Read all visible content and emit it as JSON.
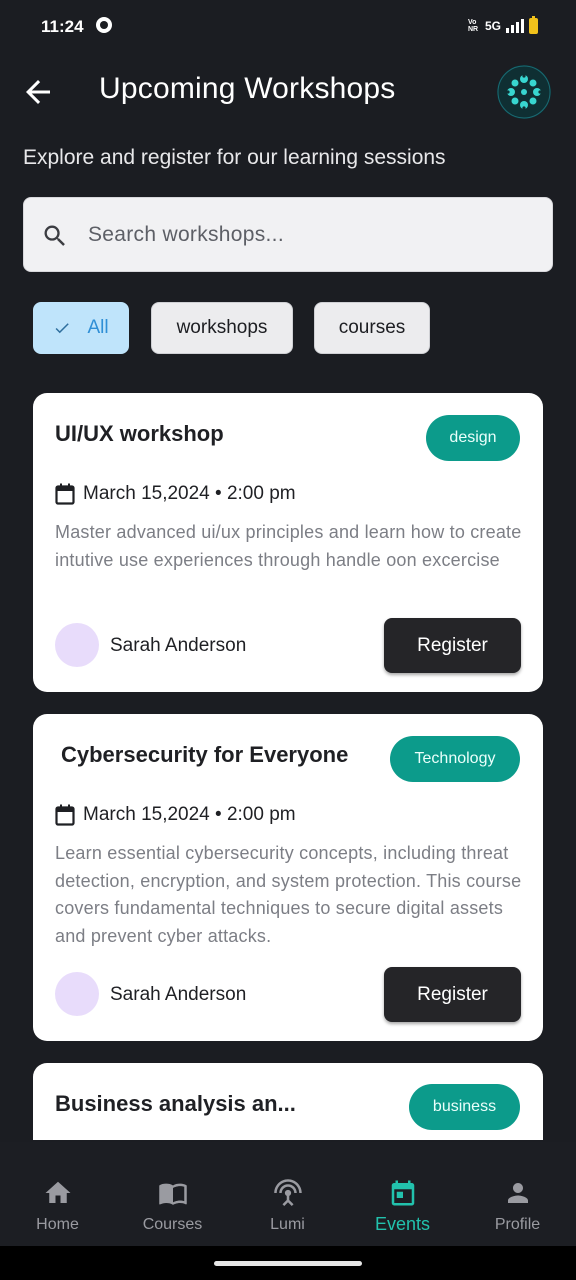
{
  "status_bar": {
    "time": "11:24",
    "network_small": "Vo\nNR",
    "network": "5G"
  },
  "header": {
    "title": "Upcoming Workshops",
    "back_icon": "arrow-left-icon",
    "logo": "app-logo"
  },
  "subtitle": "Explore and register for our learning sessions",
  "search": {
    "placeholder": "Search workshops...",
    "value": ""
  },
  "filters": [
    {
      "label": "All",
      "active": true
    },
    {
      "label": "workshops",
      "active": false
    },
    {
      "label": "courses",
      "active": false
    }
  ],
  "workshops": [
    {
      "title": "UI/UX workshop",
      "tag": "design",
      "date": "March 15,2024 • 2:00 pm",
      "description": "Master  advanced ui/ux principles and learn how to create intutive use experiences through handle oon excercise",
      "host": "Sarah Anderson",
      "register_label": "Register"
    },
    {
      "title": "Cybersecurity for Everyone",
      "tag": "Technology",
      "date": "March 15,2024 • 2:00 pm",
      "description": "Learn essential cybersecurity concepts, including threat detection, encryption, and system protection. This course covers fundamental techniques to secure digital assets and prevent cyber attacks.",
      "host": "Sarah Anderson",
      "register_label": "Register"
    },
    {
      "title": "Business analysis an...",
      "tag": "business"
    }
  ],
  "nav": [
    {
      "label": "Home",
      "icon": "home-icon",
      "active": false
    },
    {
      "label": "Courses",
      "icon": "book-icon",
      "active": false
    },
    {
      "label": "Lumi",
      "icon": "broadcast-icon",
      "active": false
    },
    {
      "label": "Events",
      "icon": "calendar-icon",
      "active": true
    },
    {
      "label": "Profile",
      "icon": "person-icon",
      "active": false
    }
  ],
  "colors": {
    "background": "#1b1d22",
    "accent": "#0c9b8b",
    "active_nav": "#22c2ad",
    "chip_active": "#bfe4fb"
  }
}
